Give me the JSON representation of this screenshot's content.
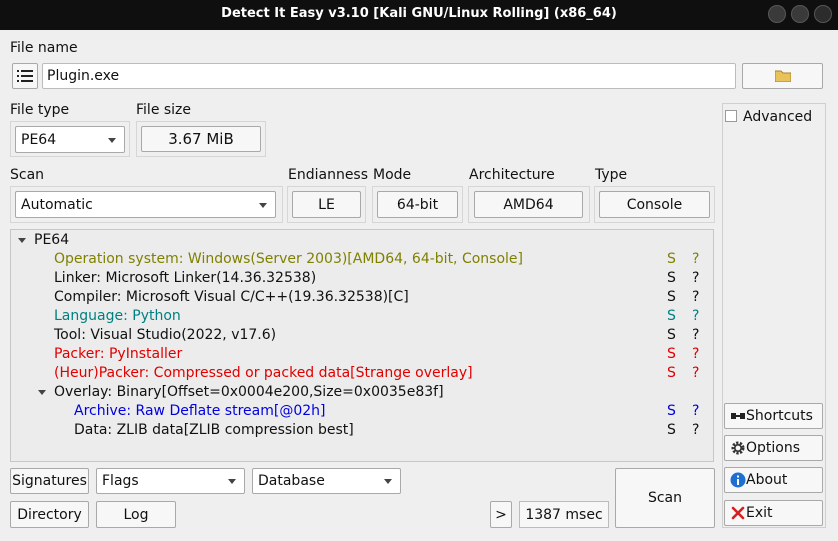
{
  "window": {
    "title": "Detect It Easy v3.10 [Kali GNU/Linux Rolling] (x86_64)"
  },
  "file": {
    "label": "File name",
    "value": "Plugin.exe"
  },
  "filetype": {
    "label": "File type",
    "value": "PE64"
  },
  "filesize": {
    "label": "File size",
    "value": "3.67 MiB"
  },
  "scan": {
    "label": "Scan",
    "value": "Automatic"
  },
  "endianness": {
    "label": "Endianness",
    "value": "LE"
  },
  "mode": {
    "label": "Mode",
    "value": "64-bit"
  },
  "architecture": {
    "label": "Architecture",
    "value": "AMD64"
  },
  "type": {
    "label": "Type",
    "value": "Console"
  },
  "advanced": {
    "label": "Advanced",
    "checked": false
  },
  "tree": {
    "root": "PE64",
    "items": [
      {
        "text": "Operation system: Windows(Server 2003)[AMD64, 64-bit, Console]",
        "s": "S",
        "q": "?",
        "color": "#808000"
      },
      {
        "text": "Linker: Microsoft Linker(14.36.32538)",
        "s": "S",
        "q": "?",
        "color": "#111111"
      },
      {
        "text": "Compiler: Microsoft Visual C/C++(19.36.32538)[C]",
        "s": "S",
        "q": "?",
        "color": "#111111"
      },
      {
        "text": "Language: Python",
        "s": "S",
        "q": "?",
        "color": "#008080"
      },
      {
        "text": "Tool: Visual Studio(2022, v17.6)",
        "s": "S",
        "q": "?",
        "color": "#111111"
      },
      {
        "text": "Packer: PyInstaller",
        "s": "S",
        "q": "?",
        "color": "#e00000"
      },
      {
        "text": "(Heur)Packer: Compressed or packed data[Strange overlay]",
        "s": "S",
        "q": "?",
        "color": "#e00000"
      },
      {
        "text": "Overlay: Binary[Offset=0x0004e200,Size=0x0035e83f]",
        "s": "",
        "q": "",
        "color": "#111111"
      },
      {
        "text": "Archive: Raw Deflate stream[@02h]",
        "s": "S",
        "q": "?",
        "color": "#0000e0"
      },
      {
        "text": "Data: ZLIB data[ZLIB compression best]",
        "s": "S",
        "q": "?",
        "color": "#111111"
      }
    ]
  },
  "bottom": {
    "signatures": "Signatures",
    "flags": "Flags",
    "database": "Database",
    "directory": "Directory",
    "log": "Log",
    "more": ">",
    "time": "1387 msec",
    "scan": "Scan"
  },
  "side": {
    "shortcuts": "Shortcuts",
    "options": "Options",
    "about": "About",
    "exit": "Exit"
  },
  "icons": [
    "menu-list-icon",
    "folder-icon",
    "shortcuts-icon",
    "gear-icon",
    "info-icon",
    "exit-icon"
  ]
}
